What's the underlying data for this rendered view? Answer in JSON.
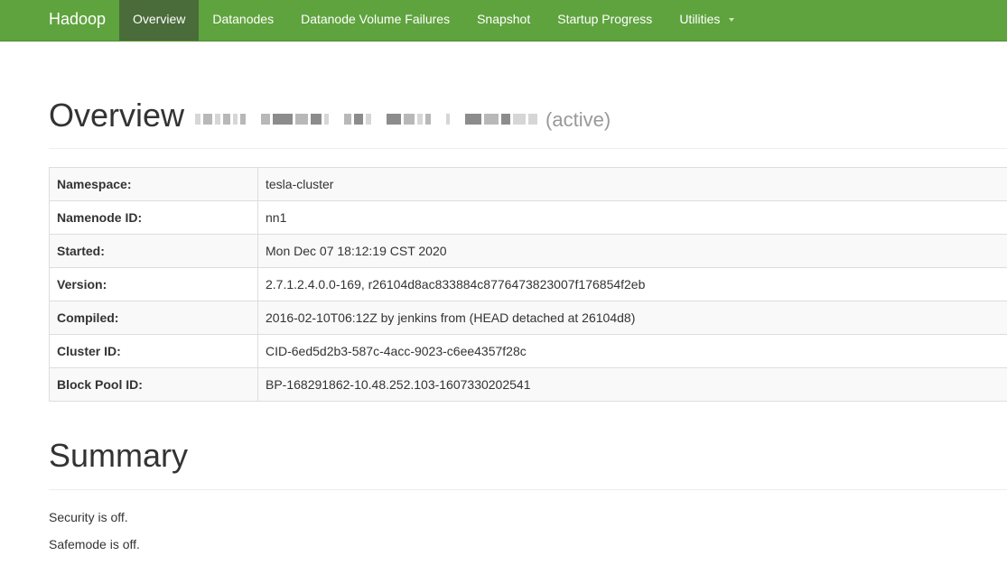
{
  "navbar": {
    "brand": "Hadoop",
    "items": [
      {
        "label": "Overview"
      },
      {
        "label": "Datanodes"
      },
      {
        "label": "Datanode Volume Failures"
      },
      {
        "label": "Snapshot"
      },
      {
        "label": "Startup Progress"
      },
      {
        "label": "Utilities"
      }
    ],
    "active_index": 0
  },
  "overview": {
    "title": "Overview",
    "state": "(active)",
    "rows": [
      {
        "label": "Namespace:",
        "value": "tesla-cluster"
      },
      {
        "label": "Namenode ID:",
        "value": "nn1"
      },
      {
        "label": "Started:",
        "value": "Mon Dec 07 18:12:19 CST 2020"
      },
      {
        "label": "Version:",
        "value": "2.7.1.2.4.0.0-169, r26104d8ac833884c8776473823007f176854f2eb"
      },
      {
        "label": "Compiled:",
        "value": "2016-02-10T06:12Z by jenkins from (HEAD detached at 26104d8)"
      },
      {
        "label": "Cluster ID:",
        "value": "CID-6ed5d2b3-587c-4acc-9023-c6ee4357f28c"
      },
      {
        "label": "Block Pool ID:",
        "value": "BP-168291862-10.48.252.103-1607330202541"
      }
    ]
  },
  "summary": {
    "title": "Summary",
    "security": "Security is off.",
    "safemode": "Safemode is off."
  },
  "colors": {
    "navbar_bg": "#5fa33e",
    "navbar_active_bg": "#4a6b3a"
  }
}
